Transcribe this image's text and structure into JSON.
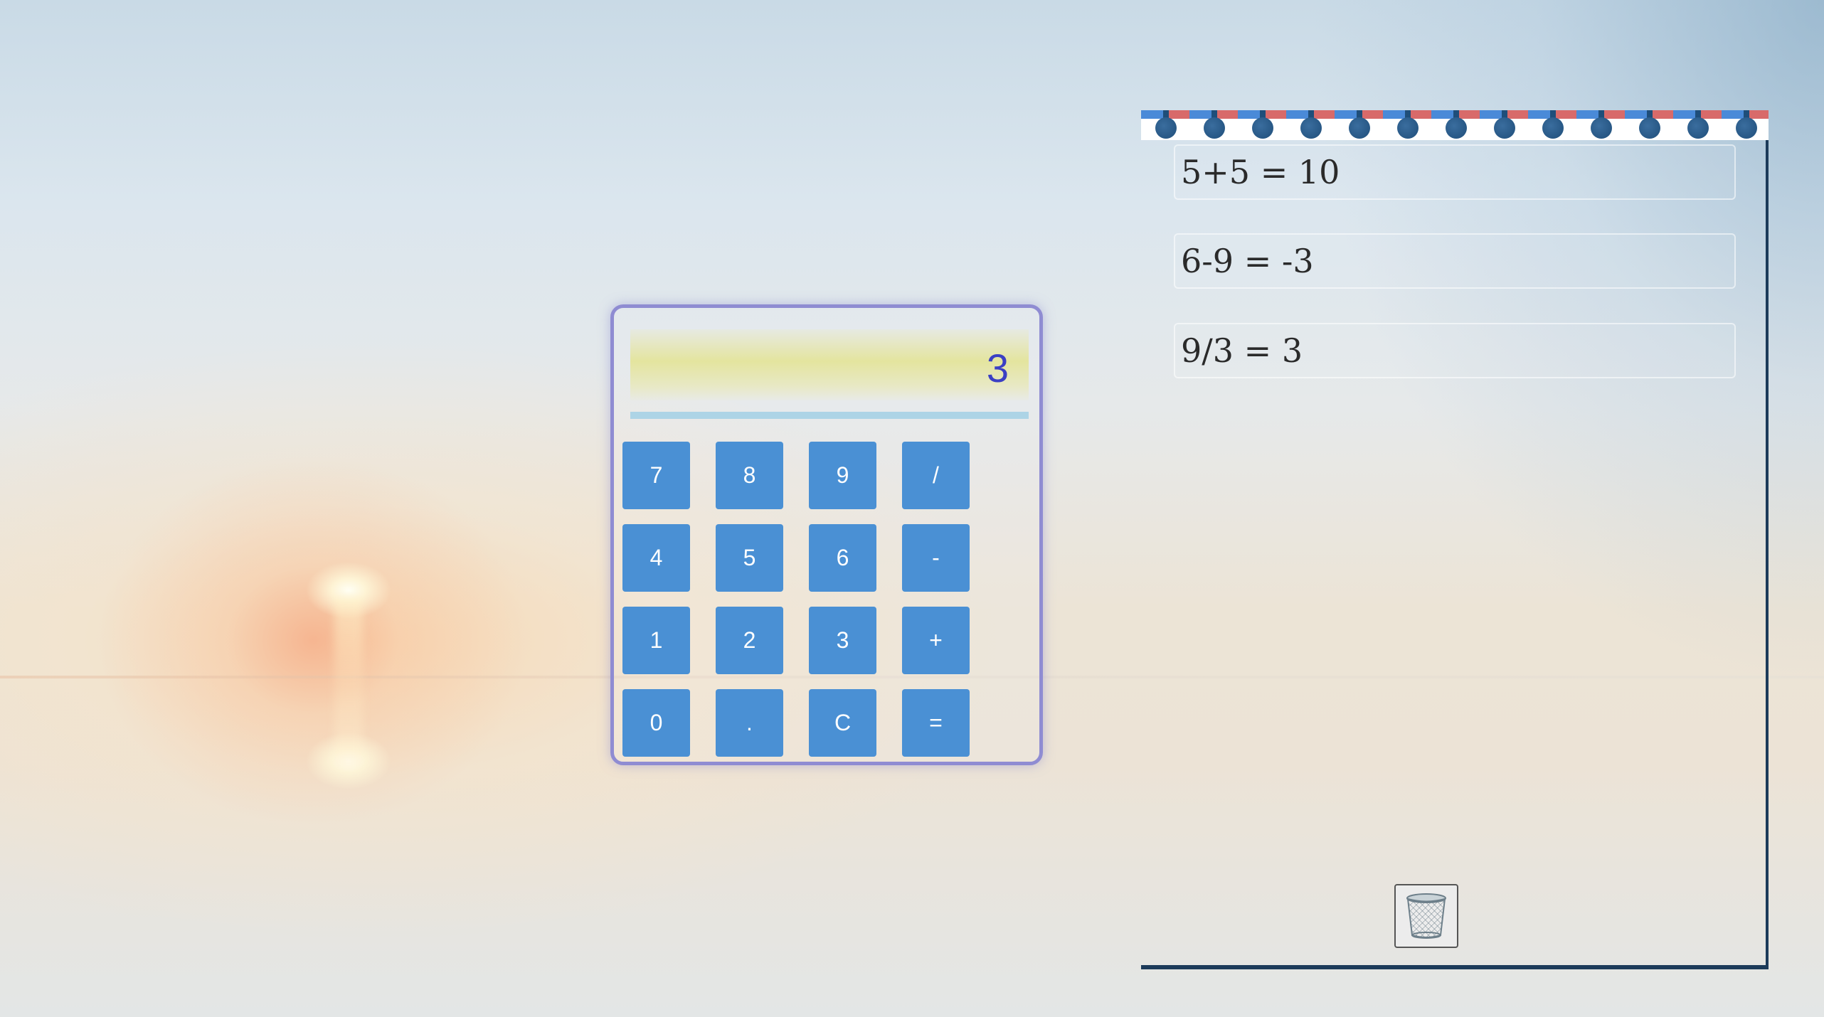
{
  "calculator": {
    "display_value": "3",
    "keys": [
      {
        "label": "7",
        "name": "key-7"
      },
      {
        "label": "8",
        "name": "key-8"
      },
      {
        "label": "9",
        "name": "key-9"
      },
      {
        "label": "/",
        "name": "key-divide"
      },
      {
        "label": "4",
        "name": "key-4"
      },
      {
        "label": "5",
        "name": "key-5"
      },
      {
        "label": "6",
        "name": "key-6"
      },
      {
        "label": "-",
        "name": "key-subtract"
      },
      {
        "label": "1",
        "name": "key-1"
      },
      {
        "label": "2",
        "name": "key-2"
      },
      {
        "label": "3",
        "name": "key-3"
      },
      {
        "label": "+",
        "name": "key-add"
      },
      {
        "label": "0",
        "name": "key-0"
      },
      {
        "label": ".",
        "name": "key-decimal"
      },
      {
        "label": "C",
        "name": "key-clear"
      },
      {
        "label": "=",
        "name": "key-equals"
      }
    ]
  },
  "history": {
    "items": [
      "5+5 = 10",
      "6-9 = -3",
      "9/3 = 3"
    ],
    "trash_icon": "trash-can-icon"
  },
  "colors": {
    "key_bg": "#4a90d4",
    "calc_border": "#8f8cd2",
    "display_text": "#3b3fc4",
    "pad_border": "#1c3b5a"
  }
}
